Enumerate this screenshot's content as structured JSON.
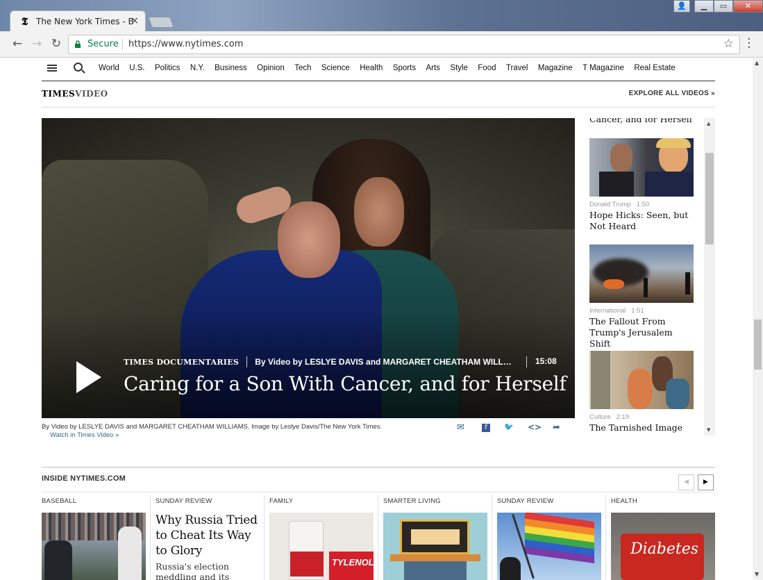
{
  "browser": {
    "tab_title": "The New York Times - Br",
    "tab_close": "×",
    "secure_label": "Secure",
    "url": "https://www.nytimes.com",
    "brand_favicon": "𝕿"
  },
  "nav": {
    "items": [
      "World",
      "U.S.",
      "Politics",
      "N.Y.",
      "Business",
      "Opinion",
      "Tech",
      "Science",
      "Health",
      "Sports",
      "Arts",
      "Style",
      "Food",
      "Travel",
      "Magazine",
      "T Magazine",
      "Real Estate"
    ]
  },
  "video_section": {
    "head_times": "TIMES",
    "head_video": "VIDEO",
    "explore": "EXPLORE ALL VIDEOS »",
    "player": {
      "section": "TIMES DOCUMENTARIES",
      "byline": "By Video by LESLYE DAVIS and MARGARET CHEATHAM WILLIAMS",
      "duration": "15:08",
      "title": "Caring for a Son With Cancer, and for Herself"
    },
    "credit": "By Video by LESLYE DAVIS and MARGARET CHEATHAM WILLIAMS. Image by Leslye Davis/The New York Times.",
    "watch_link": "Watch in Times Video »",
    "share_icons": [
      "✉",
      "f",
      "🐦",
      "<>",
      "➦"
    ],
    "sidebar": {
      "cut_title": "Cancer, and for Herself",
      "items": [
        {
          "category": "Donald Trump",
          "duration": "1:50",
          "headline": "Hope Hicks: Seen, but Not Heard"
        },
        {
          "category": "International",
          "duration": "1:51",
          "headline": "The Fallout From Trump's Jerusalem Shift"
        },
        {
          "category": "Culture",
          "duration": "2:19",
          "headline": "The Tarnished Image of"
        }
      ]
    }
  },
  "inside": {
    "heading": "INSIDE NYTIMES.COM",
    "prev": "◀",
    "next": "▶",
    "columns": [
      {
        "kicker": "BASEBALL",
        "headline": "",
        "summary": ""
      },
      {
        "kicker": "SUNDAY REVIEW",
        "headline": "Why Russia Tried to Cheat Its Way to Glory",
        "summary": "Russia's election meddling and its Olympic doping are"
      },
      {
        "kicker": "FAMILY",
        "headline": "",
        "summary": ""
      },
      {
        "kicker": "SMARTER LIVING",
        "headline": "",
        "summary": ""
      },
      {
        "kicker": "SUNDAY REVIEW",
        "headline": "",
        "summary": ""
      },
      {
        "kicker": "HEALTH",
        "headline": "",
        "summary": ""
      }
    ],
    "tylenol_text": "TYLENOL",
    "diabetes_text": "Diabetes"
  }
}
